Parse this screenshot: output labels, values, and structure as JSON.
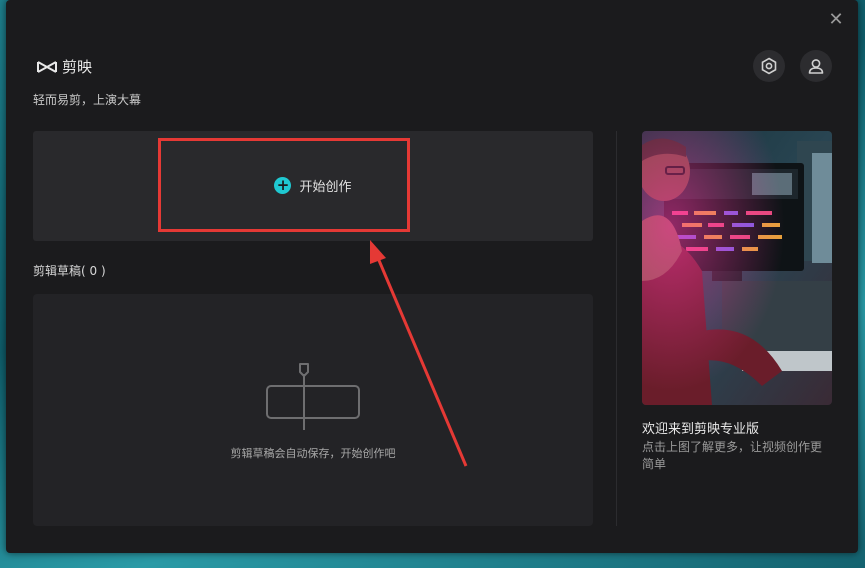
{
  "window": {
    "close_glyph": "✕"
  },
  "header": {
    "app_name": "剪映",
    "tagline": "轻而易剪，上演大幕",
    "settings_icon": "hexagon-settings-icon",
    "user_icon": "user-icon"
  },
  "start": {
    "plus_glyph": "+",
    "label": "开始创作"
  },
  "drafts": {
    "title": "剪辑草稿( 0 )",
    "empty_message": "剪辑草稿会自动保存，开始创作吧"
  },
  "promo": {
    "title": "欢迎来到剪映专业版",
    "description": "点击上图了解更多，让视频创作更简单"
  },
  "colors": {
    "accent": "#1fc8d1",
    "highlight": "#e53935",
    "window_bg": "#1b1b1d"
  }
}
